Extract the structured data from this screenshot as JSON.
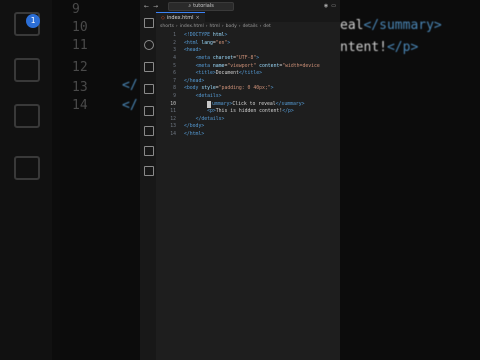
{
  "titlebar": {
    "search_text": "tutorials"
  },
  "tab": {
    "filename": "index.html",
    "close": "×"
  },
  "breadcrumb": [
    "shorts",
    "index.html",
    "html",
    "body",
    "details",
    "det"
  ],
  "code": [
    {
      "n": "1",
      "tokens": [
        [
          "t-tag",
          "<!DOCTYPE "
        ],
        [
          "t-attr",
          "html"
        ],
        [
          "t-tag",
          ">"
        ]
      ]
    },
    {
      "n": "2",
      "tokens": [
        [
          "t-tag",
          "<html "
        ],
        [
          "t-attr",
          "lang"
        ],
        [
          "t-txt",
          "="
        ],
        [
          "t-str",
          "\"en\""
        ],
        [
          "t-tag",
          ">"
        ]
      ]
    },
    {
      "n": "3",
      "tokens": [
        [
          "t-tag",
          "<head>"
        ]
      ]
    },
    {
      "n": "4",
      "tokens": [
        [
          "t-txt",
          "    "
        ],
        [
          "t-tag",
          "<meta "
        ],
        [
          "t-attr",
          "charset"
        ],
        [
          "t-txt",
          "="
        ],
        [
          "t-str",
          "\"UTF-8\""
        ],
        [
          "t-tag",
          ">"
        ]
      ]
    },
    {
      "n": "5",
      "tokens": [
        [
          "t-txt",
          "    "
        ],
        [
          "t-tag",
          "<meta "
        ],
        [
          "t-attr",
          "name"
        ],
        [
          "t-txt",
          "="
        ],
        [
          "t-str",
          "\"viewport\""
        ],
        [
          "t-txt",
          " "
        ],
        [
          "t-attr",
          "content"
        ],
        [
          "t-txt",
          "="
        ],
        [
          "t-str",
          "\"width=device"
        ]
      ]
    },
    {
      "n": "6",
      "tokens": [
        [
          "t-txt",
          "    "
        ],
        [
          "t-tag",
          "<title>"
        ],
        [
          "t-txt",
          "Document"
        ],
        [
          "t-tag",
          "</title>"
        ]
      ]
    },
    {
      "n": "7",
      "tokens": [
        [
          "t-tag",
          "</head>"
        ]
      ]
    },
    {
      "n": "8",
      "tokens": [
        [
          "t-tag",
          "<body "
        ],
        [
          "t-attr",
          "style"
        ],
        [
          "t-txt",
          "="
        ],
        [
          "t-str",
          "\"padding: 0 40px;\""
        ],
        [
          "t-tag",
          ">"
        ]
      ]
    },
    {
      "n": "9",
      "tokens": [
        [
          "t-txt",
          "    "
        ],
        [
          "t-tag",
          "<details>"
        ]
      ]
    },
    {
      "n": "10",
      "active": true,
      "tokens": [
        [
          "t-txt",
          "        "
        ],
        [
          "cursor",
          ""
        ],
        [
          "t-tag",
          "ummary>"
        ],
        [
          "t-txt",
          "Click to reveal"
        ],
        [
          "t-tag",
          "</summary>"
        ]
      ]
    },
    {
      "n": "11",
      "tokens": [
        [
          "t-txt",
          "        "
        ],
        [
          "t-tag",
          "<p>"
        ],
        [
          "t-txt",
          "This is hidden content!"
        ],
        [
          "t-tag",
          "</p>"
        ]
      ]
    },
    {
      "n": "12",
      "tokens": [
        [
          "t-txt",
          "    "
        ],
        [
          "t-tag",
          "</details>"
        ]
      ]
    },
    {
      "n": "13",
      "tokens": [
        [
          "t-tag",
          "</body>"
        ]
      ]
    },
    {
      "n": "14",
      "tokens": [
        [
          "t-tag",
          "</html>"
        ]
      ]
    }
  ],
  "background": {
    "left_numbers": [
      "9",
      "10",
      "11",
      "12",
      "13",
      "14"
    ],
    "left_lines": [
      "</",
      "</"
    ],
    "right_lines": [
      {
        "a": "eal",
        "b": "</summary>"
      },
      {
        "a": "ntent!",
        "b": "</p>"
      }
    ],
    "badge": "1"
  }
}
